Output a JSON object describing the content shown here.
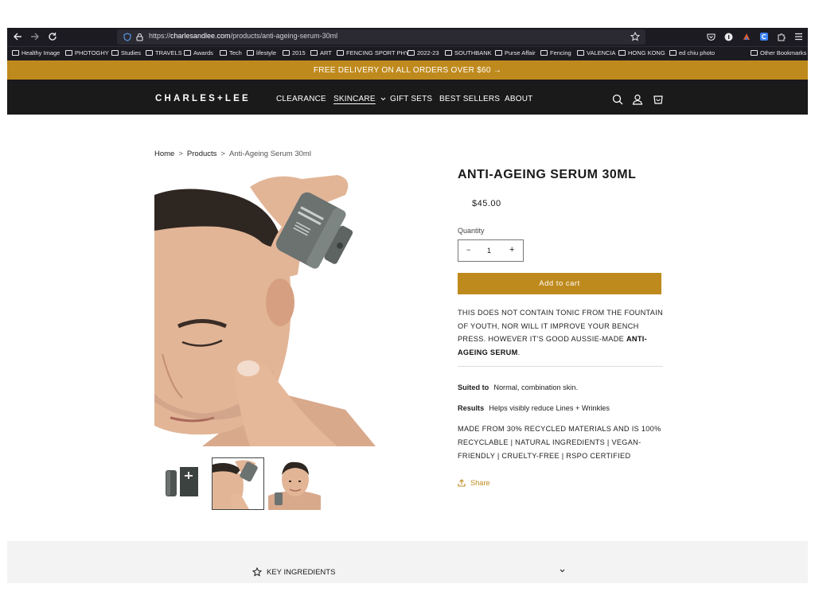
{
  "browser": {
    "url_prefix": "https://",
    "url_domain": "charlesandlee.com",
    "url_path": "/products/anti-ageing-serum-30ml"
  },
  "bookmarks": [
    "Healthy Image",
    "PHOTOGHY",
    "Studies",
    "TRAVELS",
    "Awards",
    "Tech",
    "lifestyle",
    "2015",
    "ART",
    "FENCING SPORT PHY",
    "2022-23",
    "SOUTHBANK",
    "Purse Affair",
    "Fencing",
    "VALENCIA",
    "HONG KONG",
    "ed chiu photo"
  ],
  "bookmarks_other": "Other Bookmarks",
  "announcement": "FREE DELIVERY ON ALL ORDERS OVER $60 →",
  "header": {
    "logo": "CHARLES+LEE",
    "nav": {
      "clearance": "CLEARANCE",
      "skincare": "SKINCARE",
      "gift_sets": "GIFT SETS",
      "best_sellers": "BEST SELLERS",
      "about": "ABOUT"
    }
  },
  "breadcrumb": {
    "home": "Home",
    "products": "Products",
    "current": "Anti-Ageing Serum 30ml",
    "separator": ">"
  },
  "product": {
    "title": "ANTI-AGEING SERUM 30ML",
    "price": "$45.00",
    "quantity_label": "Quantity",
    "quantity_value": "1",
    "minus": "−",
    "plus": "+",
    "add_to_cart": "Add to cart",
    "description_text": "THIS DOES NOT CONTAIN TONIC FROM THE FOUNTAIN OF YOUTH, NOR WILL IT IMPROVE YOUR BENCH PRESS.  HOWEVER IT'S GOOD AUSSIE-MADE ",
    "description_bold": "ANTI-AGEING SERUM",
    "description_end": ".",
    "suited_label": "Suited to",
    "suited_value": "Normal, combination skin.",
    "results_label": "Results",
    "results_value": "Helps visibly reduce Lines + Wrinkles",
    "made_from": "MADE FROM 30% RECYCLED MATERIALS AND IS 100% RECYCLABLE | NATURAL INGREDIENTS | VEGAN-FRIENDLY | CRUELTY-FREE | RSPO CERTIFIED",
    "share": "Share"
  },
  "key_ingredients": "KEY INGREDIENTS",
  "colors": {
    "accent": "#bf8a1d",
    "header_bg": "#1a1a1a",
    "browser_bg": "#1c1b22"
  }
}
